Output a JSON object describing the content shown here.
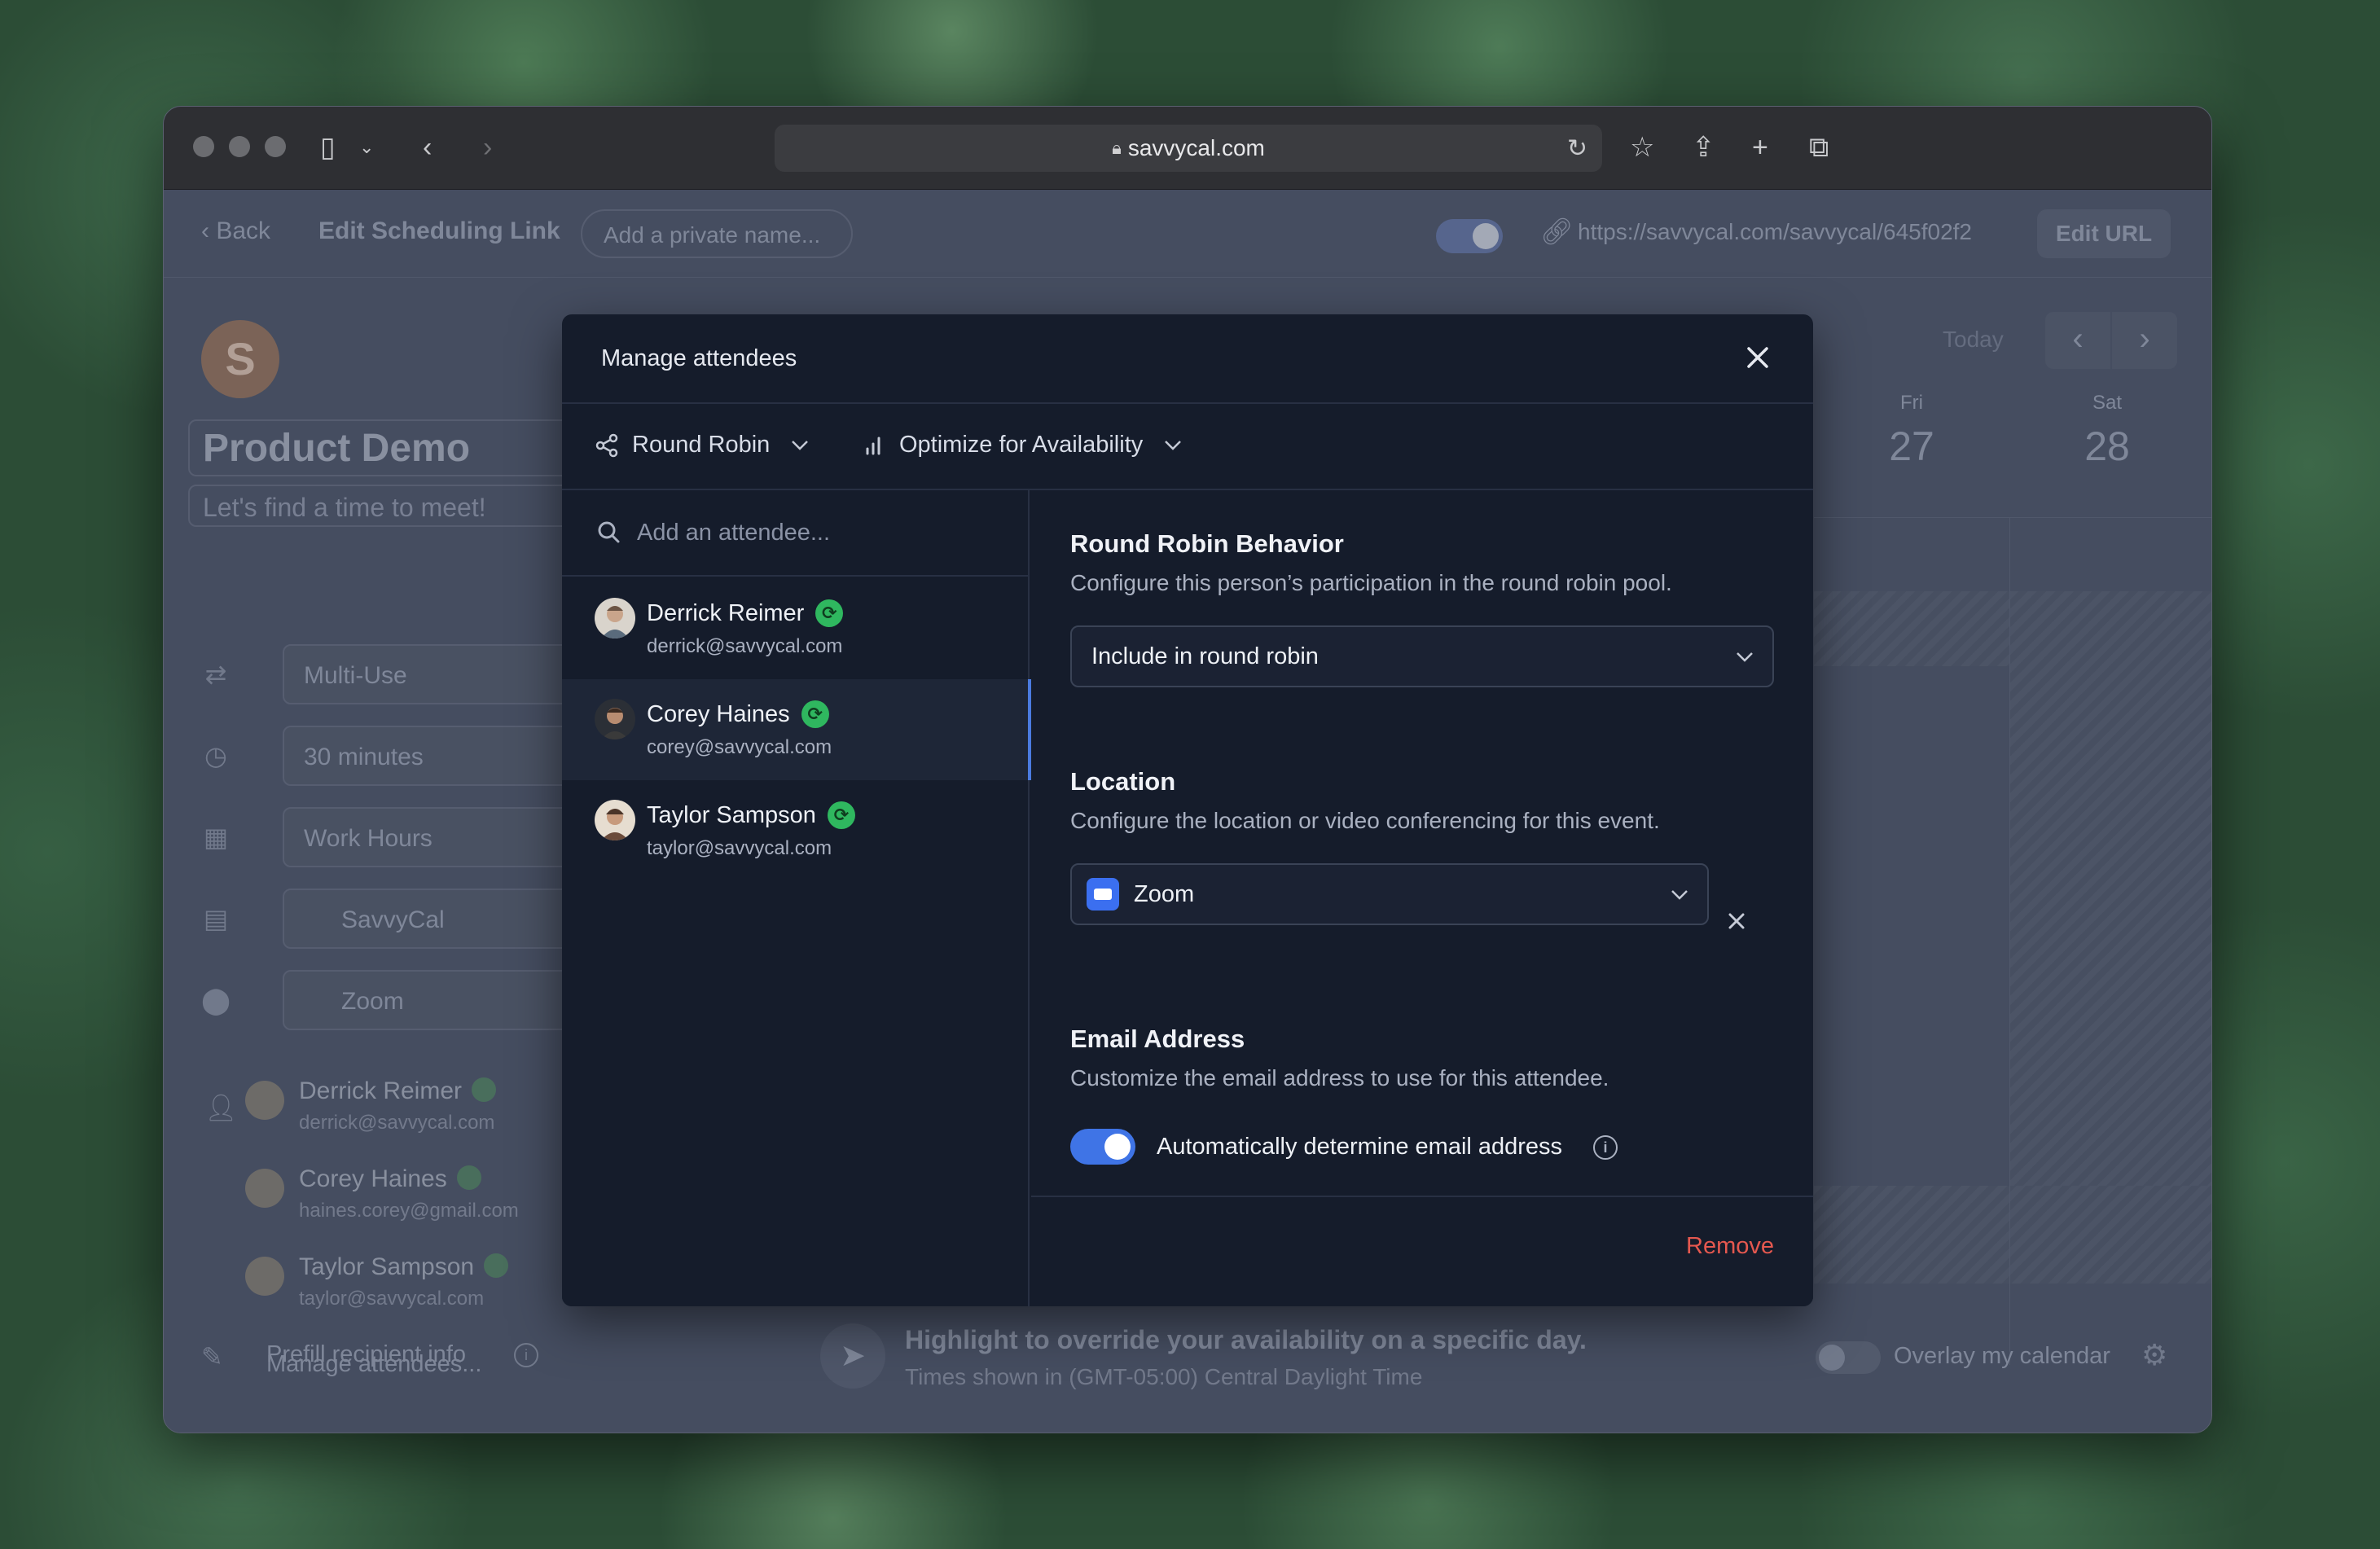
{
  "browser": {
    "url": "savvycal.com"
  },
  "topbar": {
    "back_label": "Back",
    "title": "Edit Scheduling Link",
    "private_name_placeholder": "Add a private name...",
    "link_url": "https://savvycal.com/savvycal/645f02f2",
    "edit_url_label": "Edit URL"
  },
  "background_page": {
    "avatar_letter": "S",
    "event_title": "Product Demo",
    "event_subtitle": "Let's find a time to meet!",
    "fields": [
      {
        "icon": "repeat-icon",
        "value": "Multi-Use"
      },
      {
        "icon": "clock-icon",
        "value": "30 minutes"
      },
      {
        "icon": "grid-icon",
        "value": "Work Hours"
      },
      {
        "icon": "calendar-icon",
        "value": "SavvyCal"
      },
      {
        "icon": "location-icon",
        "value": "Zoom"
      }
    ],
    "attendees": [
      {
        "name": "Derrick Reimer",
        "email": "derrick@savvycal.com"
      },
      {
        "name": "Corey Haines",
        "email": "haines.corey@gmail.com"
      },
      {
        "name": "Taylor Sampson",
        "email": "taylor@savvycal.com"
      }
    ],
    "manage_attendees_link": "Manage attendees...",
    "prefill_label": "Prefill recipient info",
    "calendar": {
      "today_label": "Today",
      "days": [
        {
          "dow": "Fri",
          "date": "27"
        },
        {
          "dow": "Sat",
          "date": "28"
        }
      ]
    },
    "hint_title": "Highlight to override your availability on a specific day.",
    "hint_sub": "Times shown in (GMT-05:00) Central Daylight Time",
    "overlay_label": "Overlay my calendar"
  },
  "modal": {
    "title": "Manage attendees",
    "toolbar": {
      "mode_label": "Round Robin",
      "optimize_label": "Optimize for Availability"
    },
    "search_placeholder": "Add an attendee...",
    "attendees": [
      {
        "name": "Derrick Reimer",
        "email": "derrick@savvycal.com",
        "active": false
      },
      {
        "name": "Corey Haines",
        "email": "corey@savvycal.com",
        "active": true
      },
      {
        "name": "Taylor Sampson",
        "email": "taylor@savvycal.com",
        "active": false
      }
    ],
    "round_robin": {
      "title": "Round Robin Behavior",
      "description": "Configure this person’s participation in the round robin pool.",
      "selected": "Include in round robin"
    },
    "location": {
      "title": "Location",
      "description": "Configure the location or video conferencing for this event.",
      "selected": "Zoom"
    },
    "email": {
      "title": "Email Address",
      "description": "Customize the email address to use for this attendee.",
      "toggle_label": "Automatically determine email address",
      "toggle_on": true
    },
    "remove_label": "Remove"
  },
  "colors": {
    "accent": "#3f74e6",
    "danger": "#e5584f",
    "sync_green": "#2fb75f",
    "modal_bg": "#151c2b"
  }
}
